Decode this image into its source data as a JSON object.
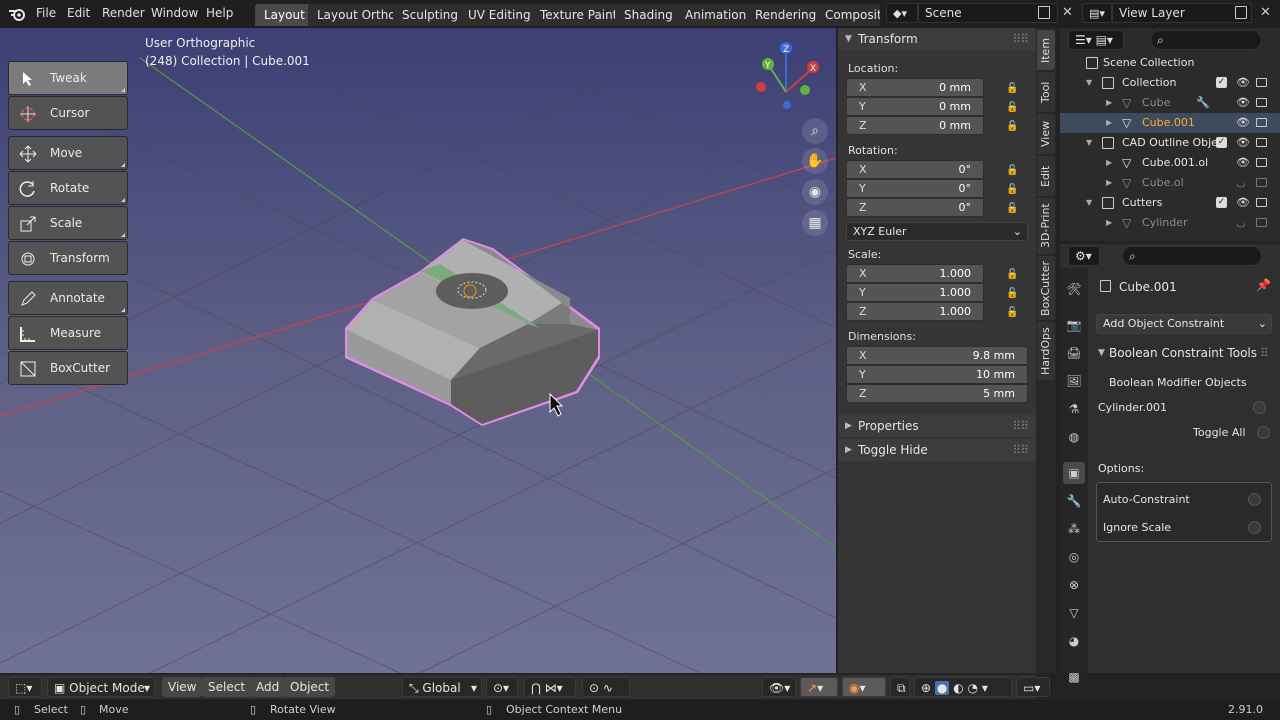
{
  "menu": {
    "file": "File",
    "edit": "Edit",
    "render": "Render",
    "window": "Window",
    "help": "Help"
  },
  "workspaces": [
    "Layout",
    "Layout Ortho",
    "Sculpting",
    "UV Editing",
    "Texture Paint",
    "Shading",
    "Animation",
    "Rendering",
    "Compositi"
  ],
  "scene": {
    "label": "Scene"
  },
  "view_layer": {
    "label": "View Layer"
  },
  "viewport": {
    "view_name": "User Orthographic",
    "collection_info": "(248) Collection | Cube.001"
  },
  "tools": [
    "Tweak",
    "Cursor",
    "Move",
    "Rotate",
    "Scale",
    "Transform",
    "Annotate",
    "Measure",
    "BoxCutter"
  ],
  "header": {
    "mode": "Object Mode",
    "view": "View",
    "select": "Select",
    "add": "Add",
    "object": "Object",
    "orientation": "Global"
  },
  "transform": {
    "title": "Transform",
    "location_label": "Location:",
    "location": [
      {
        "axis": "X",
        "value": "0 mm"
      },
      {
        "axis": "Y",
        "value": "0 mm"
      },
      {
        "axis": "Z",
        "value": "0 mm"
      }
    ],
    "rotation_label": "Rotation:",
    "rotation": [
      {
        "axis": "X",
        "value": "0°"
      },
      {
        "axis": "Y",
        "value": "0°"
      },
      {
        "axis": "Z",
        "value": "0°"
      }
    ],
    "rotation_mode": "XYZ Euler",
    "scale_label": "Scale:",
    "scale": [
      {
        "axis": "X",
        "value": "1.000"
      },
      {
        "axis": "Y",
        "value": "1.000"
      },
      {
        "axis": "Z",
        "value": "1.000"
      }
    ],
    "dimensions_label": "Dimensions:",
    "dimensions": [
      {
        "axis": "X",
        "value": "9.8 mm"
      },
      {
        "axis": "Y",
        "value": "10 mm"
      },
      {
        "axis": "Z",
        "value": "5 mm"
      }
    ],
    "properties": "Properties",
    "toggle_hide": "Toggle Hide"
  },
  "side_tabs": [
    "Item",
    "Tool",
    "View",
    "Edit",
    "3D-Print",
    "BoxCutter",
    "HardOps"
  ],
  "outliner": {
    "scene_collection": "Scene Collection",
    "rows": [
      {
        "name": "Collection",
        "level": 1,
        "type": "collection"
      },
      {
        "name": "Cube",
        "level": 2,
        "type": "mesh",
        "dim": true
      },
      {
        "name": "Cube.001",
        "level": 2,
        "type": "mesh",
        "selected": true
      },
      {
        "name": "CAD Outline Obje",
        "level": 1,
        "type": "collection"
      },
      {
        "name": "Cube.001.ol",
        "level": 2,
        "type": "mesh"
      },
      {
        "name": "Cube.ol",
        "level": 2,
        "type": "mesh",
        "dim": true
      },
      {
        "name": "Cutters",
        "level": 1,
        "type": "collection"
      },
      {
        "name": "Cylinder",
        "level": 2,
        "type": "mesh",
        "dim": true
      }
    ]
  },
  "properties": {
    "object_name": "Cube.001",
    "add_constraint": "Add Object Constraint",
    "panel_title": "Boolean Constraint Tools",
    "modifier_objects_label": "Boolean Modifier Objects",
    "cylinder": "Cylinder.001",
    "toggle_all": "Toggle All",
    "options_label": "Options:",
    "auto_constraint": "Auto-Constraint",
    "ignore_scale": "Ignore Scale"
  },
  "status": {
    "select": "Select",
    "move": "Move",
    "rotate_view": "Rotate View",
    "context_menu": "Object Context Menu",
    "version": "2.91.0"
  },
  "colors": {
    "accent": "#4772b3",
    "selected_orange": "#ffaf29",
    "outline_pink": "#e58ae5",
    "axis_x": "#d23c3c",
    "axis_y": "#5fb33f",
    "axis_z": "#3e68d9"
  }
}
